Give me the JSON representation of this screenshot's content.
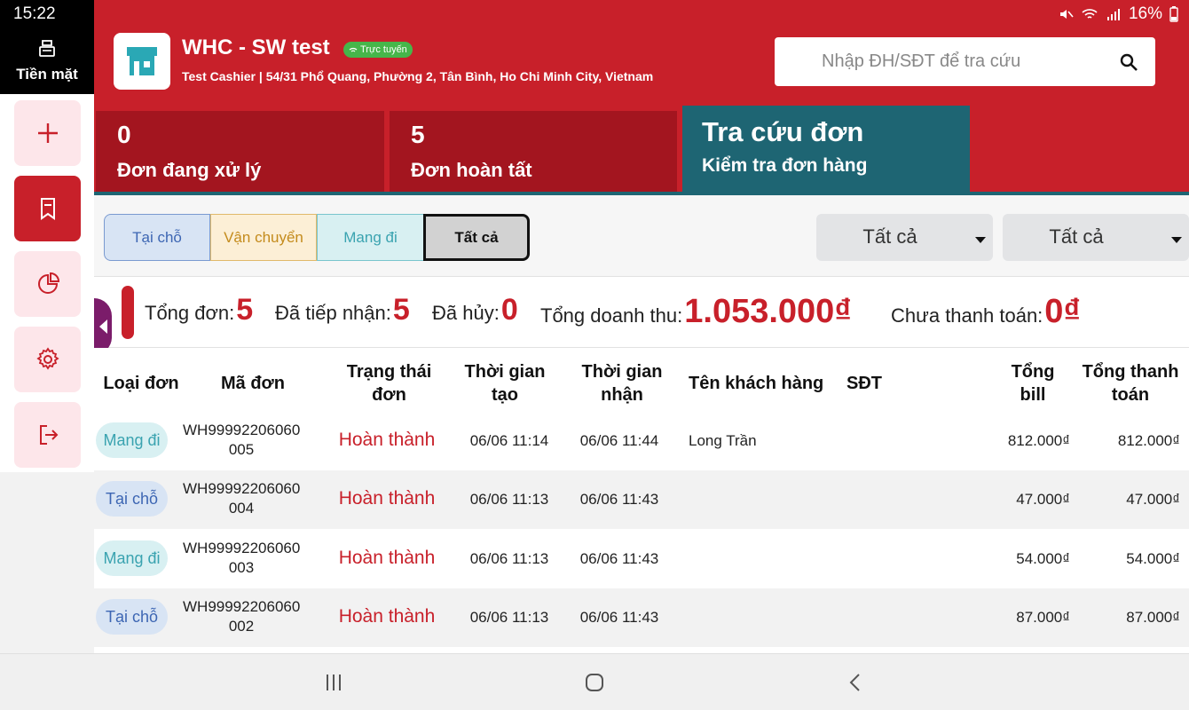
{
  "status_bar": {
    "time": "15:22",
    "battery": "16%"
  },
  "cash_tab": {
    "label": "Tiền mặt"
  },
  "header": {
    "store_name": "WHC - SW test",
    "online_label": "Trực tuyến",
    "address": "Test Cashier | 54/31 Phổ Quang, Phường 2, Tân Bình, Ho Chi Minh City, Vietnam",
    "search_placeholder": "Nhập ĐH/SĐT để tra cứu"
  },
  "tabs": {
    "processing": {
      "count": "0",
      "label": "Đơn đang xử lý"
    },
    "completed": {
      "count": "5",
      "label": "Đơn hoàn tất"
    },
    "lookup": {
      "title": "Tra cứu đơn",
      "subtitle": "Kiểm tra đơn hàng"
    }
  },
  "filters": {
    "order_types": [
      "Tại chỗ",
      "Vận chuyển",
      "Mang đi",
      "Tất cả"
    ],
    "selected_type": "Tất cả",
    "dropdown1": "Tất cả",
    "dropdown2": "Tất cả"
  },
  "summary": {
    "total_label": "Tổng đơn:",
    "total_value": "5",
    "received_label": "Đã tiếp nhận:",
    "received_value": "5",
    "cancelled_label": "Đã hủy:",
    "cancelled_value": "0",
    "revenue_label": "Tổng doanh thu:",
    "revenue_value": "1.053.000₫",
    "unpaid_label": "Chưa thanh toán:",
    "unpaid_value": "0₫"
  },
  "table": {
    "headers": {
      "type": "Loại đơn",
      "code": "Mã đơn",
      "status_1": "Trạng thái",
      "status_2": "đơn",
      "created_1": "Thời gian",
      "created_2": "tạo",
      "received_1": "Thời gian",
      "received_2": "nhận",
      "customer": "Tên khách hàng",
      "phone": "SĐT",
      "bill_1": "Tổng",
      "bill_2": "bill",
      "paid_1": "Tổng thanh",
      "paid_2": "toán"
    },
    "rows": [
      {
        "type": "Mang đi",
        "code_1": "WH99992206060",
        "code_2": "005",
        "status": "Hoàn thành",
        "created": "06/06 11:14",
        "received": "06/06 11:44",
        "customer": "Long Trần",
        "phone": "",
        "bill": "812.000₫",
        "paid": "812.000₫"
      },
      {
        "type": "Tại chỗ",
        "code_1": "WH99992206060",
        "code_2": "004",
        "status": "Hoàn thành",
        "created": "06/06 11:13",
        "received": "06/06 11:43",
        "customer": "",
        "phone": "",
        "bill": "47.000₫",
        "paid": "47.000₫"
      },
      {
        "type": "Mang đi",
        "code_1": "WH99992206060",
        "code_2": "003",
        "status": "Hoàn thành",
        "created": "06/06 11:13",
        "received": "06/06 11:43",
        "customer": "",
        "phone": "",
        "bill": "54.000₫",
        "paid": "54.000₫"
      },
      {
        "type": "Tại chỗ",
        "code_1": "WH99992206060",
        "code_2": "002",
        "status": "Hoàn thành",
        "created": "06/06 11:13",
        "received": "06/06 11:43",
        "customer": "",
        "phone": "",
        "bill": "87.000₫",
        "paid": "87.000₫"
      }
    ]
  },
  "colors": {
    "brand_red": "#c8202a",
    "teal": "#1e6573",
    "dark_red": "#a3151f"
  }
}
